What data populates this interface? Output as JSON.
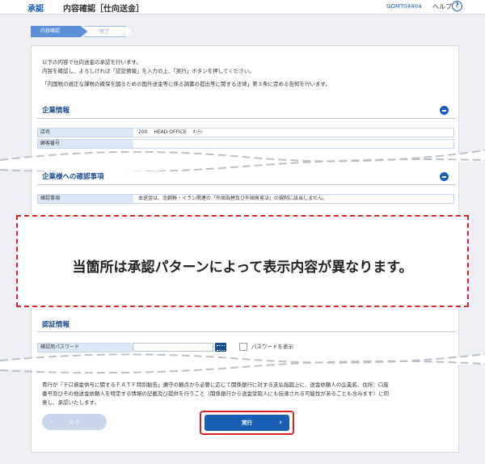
{
  "header": {
    "section": "承認",
    "title": "内容確認［仕向送金］",
    "page_id": "GOMT04404",
    "help_label": "ヘルプ",
    "help_icon": "?"
  },
  "steps": [
    {
      "label": "内容確認",
      "active": true
    },
    {
      "label": "完了",
      "active": false
    }
  ],
  "intro": [
    "以下の内容で仕向送金の承認を行います。",
    "内容を確認し、よろしければ「認証情報」を入力の上、「実行」ボタンを押してください。",
    "「内国税の適正な課税の確保を図るための国外送金等に係る調書の提出等に関する法律」第３条に定める告知を行います。"
  ],
  "company_section": {
    "title": "企業情報",
    "rows": [
      {
        "label": "店名",
        "value": "200　 HEAD OFFICE　 ﾎﾝﾃﾝ"
      },
      {
        "label": "顧客番号",
        "value": ""
      }
    ]
  },
  "confirm_section": {
    "title": "企業様への確認事項",
    "rows": [
      {
        "label": "確認事項",
        "value": "本送金は、北朝鮮・イラン関連の「外国為替及び外国貿易法」の規制に該当しません。"
      }
    ]
  },
  "notice": "当箇所は承認パターンによって表示内容が異なります。",
  "auth_section": {
    "title": "認証情報",
    "password_label": "確認用パスワード",
    "show_password_label": "パスワードを表示"
  },
  "footer_text": [
    "貴行が「テロ資金供与に関するＦＡＴＦ特別勧告」遵守の観点から必要に応じて関係銀行に対する支払指図上に、送金依頼人の企業名、住所、口座",
    "番号及びその他送金依頼人を特定する情報の記載及び提供を行うこと（関係銀行から送金受取人にも伝達される可能性があることも含みます）に同",
    "意し、承認いたします。"
  ],
  "buttons": {
    "back": "戻る",
    "execute": "実行"
  },
  "colors": {
    "accent": "#1a5fb4",
    "highlight": "#d9242b",
    "label_bg": "#dbe9f7"
  }
}
